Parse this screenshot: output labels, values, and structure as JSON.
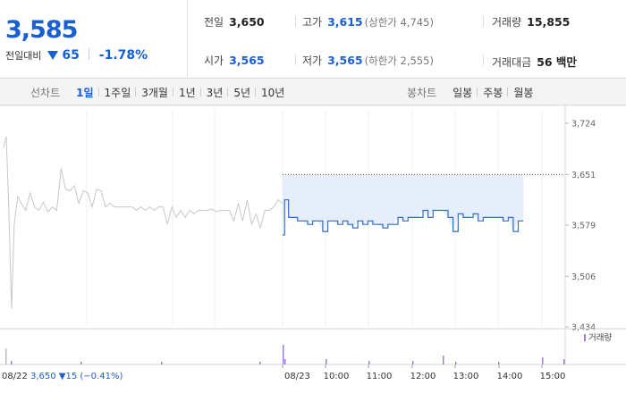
{
  "quote": {
    "price": "3,585",
    "change_label": "전일대비",
    "change_icon": "down-triangle-icon",
    "change_amount": "65",
    "change_rate": "-1.78%",
    "accent_down": "#1a5fd0",
    "stats": {
      "prev_close": {
        "label": "전일",
        "value": "3,650"
      },
      "high": {
        "label": "고가",
        "value": "3,615",
        "sub": "(상한가 4,745)"
      },
      "volume": {
        "label": "거래량",
        "value": "15,855"
      },
      "open": {
        "label": "시가",
        "value": "3,565"
      },
      "low": {
        "label": "저가",
        "value": "3,565",
        "sub": "(하한가 2,555)"
      },
      "trade_value": {
        "label": "거래대금",
        "value": "56 백만"
      }
    }
  },
  "tabs": {
    "line_title": "선차트",
    "line_tabs": [
      "1일",
      "1주일",
      "3개월",
      "1년",
      "3년",
      "5년",
      "10년"
    ],
    "line_active": "1일",
    "candle_title": "봉차트",
    "candle_tabs": [
      "일봉",
      "주봉",
      "월봉"
    ]
  },
  "chart_data": {
    "type": "line",
    "y_ticks": [
      "3,724",
      "3,651",
      "3,579",
      "3,506",
      "3,434"
    ],
    "ylim": [
      3434,
      3724
    ],
    "prev_day": {
      "date": "08/22",
      "close": "3,650",
      "change": "▼15",
      "change_rate": "(−0.41%)",
      "color": "#c8c8c8"
    },
    "today": {
      "date": "08/23",
      "x_ticks": [
        "10:00",
        "11:00",
        "12:00",
        "13:00",
        "14:00",
        "15:00"
      ],
      "color": "#2f6fc9",
      "fill": "#e6eefb"
    },
    "reference_line": 3651,
    "volume_legend": "거래량",
    "volume_color": "#9b7fd4",
    "series_prev": [
      [
        0.0,
        3690
      ],
      [
        0.3,
        3705
      ],
      [
        0.6,
        3600
      ],
      [
        0.9,
        3460
      ],
      [
        1.2,
        3580
      ],
      [
        1.6,
        3620
      ],
      [
        2.0,
        3610
      ],
      [
        2.5,
        3600
      ],
      [
        3.0,
        3625
      ],
      [
        3.5,
        3605
      ],
      [
        4.0,
        3600
      ],
      [
        4.5,
        3612
      ],
      [
        5.0,
        3598
      ],
      [
        5.5,
        3605
      ],
      [
        6.0,
        3600
      ],
      [
        6.5,
        3660
      ],
      [
        7.0,
        3630
      ],
      [
        7.5,
        3628
      ],
      [
        8.0,
        3635
      ],
      [
        8.5,
        3610
      ],
      [
        9.0,
        3628
      ],
      [
        9.5,
        3625
      ],
      [
        10.0,
        3605
      ],
      [
        10.5,
        3630
      ],
      [
        11.0,
        3628
      ],
      [
        11.5,
        3605
      ],
      [
        12.0,
        3610
      ],
      [
        12.5,
        3605
      ],
      [
        13.0,
        3605
      ],
      [
        13.5,
        3605
      ],
      [
        14.0,
        3605
      ],
      [
        14.5,
        3605
      ],
      [
        15.0,
        3600
      ],
      [
        15.5,
        3605
      ],
      [
        16.0,
        3600
      ],
      [
        16.5,
        3605
      ],
      [
        17.0,
        3600
      ],
      [
        17.5,
        3605
      ],
      [
        18.0,
        3605
      ],
      [
        18.5,
        3580
      ],
      [
        19.0,
        3605
      ],
      [
        19.5,
        3590
      ],
      [
        20.0,
        3600
      ],
      [
        20.5,
        3590
      ],
      [
        21.0,
        3600
      ],
      [
        21.5,
        3595
      ],
      [
        22.0,
        3600
      ],
      [
        22.5,
        3600
      ],
      [
        23.0,
        3600
      ],
      [
        23.5,
        3602
      ],
      [
        24.0,
        3598
      ],
      [
        24.5,
        3600
      ],
      [
        25.0,
        3600
      ],
      [
        25.5,
        3600
      ],
      [
        26.0,
        3585
      ],
      [
        26.5,
        3610
      ],
      [
        27.0,
        3585
      ],
      [
        27.5,
        3615
      ],
      [
        28.0,
        3580
      ],
      [
        28.5,
        3595
      ],
      [
        29.0,
        3575
      ],
      [
        29.5,
        3600
      ],
      [
        30.0,
        3600
      ],
      [
        30.5,
        3605
      ],
      [
        31.0,
        3615
      ],
      [
        31.5,
        3610
      ]
    ],
    "series_today": [
      [
        0.0,
        3565
      ],
      [
        0.2,
        3615
      ],
      [
        0.6,
        3590
      ],
      [
        1.0,
        3590
      ],
      [
        1.5,
        3585
      ],
      [
        2.0,
        3585
      ],
      [
        2.5,
        3580
      ],
      [
        3.0,
        3585
      ],
      [
        3.5,
        3585
      ],
      [
        4.0,
        3570
      ],
      [
        4.5,
        3585
      ],
      [
        5.0,
        3585
      ],
      [
        5.5,
        3580
      ],
      [
        6.0,
        3585
      ],
      [
        6.5,
        3580
      ],
      [
        7.0,
        3575
      ],
      [
        7.5,
        3585
      ],
      [
        8.0,
        3580
      ],
      [
        8.5,
        3585
      ],
      [
        9.0,
        3580
      ],
      [
        9.5,
        3580
      ],
      [
        10.0,
        3575
      ],
      [
        10.5,
        3580
      ],
      [
        11.0,
        3580
      ],
      [
        11.5,
        3590
      ],
      [
        12.0,
        3585
      ],
      [
        12.5,
        3590
      ],
      [
        13.0,
        3590
      ],
      [
        13.5,
        3590
      ],
      [
        14.0,
        3600
      ],
      [
        14.5,
        3590
      ],
      [
        15.0,
        3600
      ],
      [
        15.5,
        3600
      ],
      [
        16.0,
        3600
      ],
      [
        16.5,
        3590
      ],
      [
        17.0,
        3570
      ],
      [
        17.5,
        3595
      ],
      [
        18.0,
        3590
      ],
      [
        18.5,
        3590
      ],
      [
        19.0,
        3595
      ],
      [
        19.5,
        3585
      ],
      [
        20.0,
        3590
      ],
      [
        20.5,
        3590
      ],
      [
        21.0,
        3590
      ],
      [
        21.5,
        3590
      ],
      [
        22.0,
        3585
      ],
      [
        22.5,
        3590
      ],
      [
        23.0,
        3570
      ],
      [
        23.5,
        3585
      ],
      [
        24.0,
        3585
      ]
    ]
  }
}
